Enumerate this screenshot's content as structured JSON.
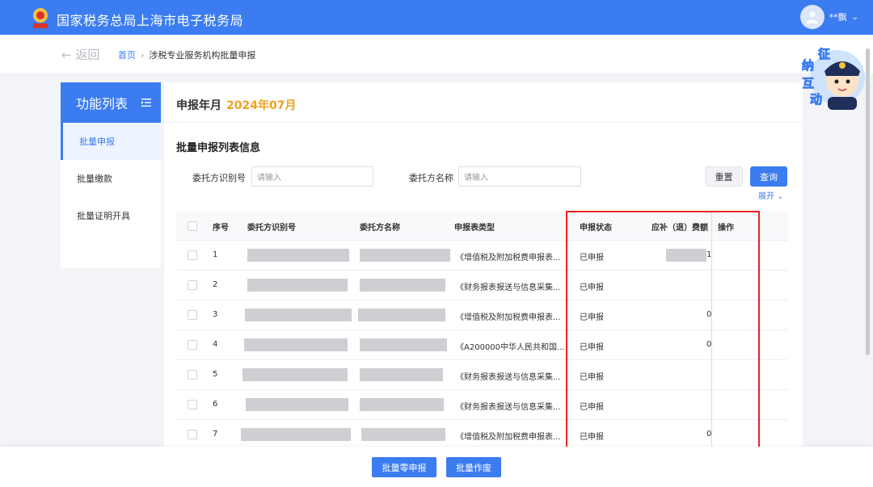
{
  "header": {
    "site_title": "国家税务总局上海市电子税务局",
    "user_name": "**飘",
    "logo_icon": "tax-emblem-icon",
    "user_icon": "user-avatar-icon"
  },
  "breadcrumb": {
    "back_label": "← 返回",
    "home": "首页",
    "separator": "›",
    "current": "涉税专业服务机构批量申报"
  },
  "mascot": {
    "chars": [
      "征",
      "纳",
      "互",
      "动"
    ]
  },
  "sidebar": {
    "title": "功能列表",
    "items": [
      {
        "label": "批量申报",
        "active": true
      },
      {
        "label": "批量缴款",
        "active": false
      },
      {
        "label": "批量证明开具",
        "active": false
      }
    ]
  },
  "main": {
    "period_label": "申报年月",
    "period_value": "2024年07月",
    "section_title": "批量申报列表信息",
    "filters": {
      "id_label": "委托方识别号",
      "id_placeholder": "请输入",
      "name_label": "委托方名称",
      "name_placeholder": "请输入"
    },
    "buttons": {
      "reset": "重置",
      "query": "查询",
      "expand": "展开 ⌄"
    }
  },
  "table": {
    "headers": [
      "序号",
      "委托方识别号",
      "委托方名称",
      "申报表类型",
      "申报状态",
      "应补（退）费额",
      "操作"
    ],
    "rows": [
      {
        "no": "1",
        "type": "《增值税及附加税费申报表...",
        "status": "已申报",
        "amount": "1"
      },
      {
        "no": "2",
        "type": "《财务报表报送与信息采集...",
        "status": "已申报",
        "amount": ""
      },
      {
        "no": "3",
        "type": "《增值税及附加税费申报表...",
        "status": "已申报",
        "amount": "0"
      },
      {
        "no": "4",
        "type": "《A200000中华人民共和国...",
        "status": "已申报",
        "amount": "0"
      },
      {
        "no": "5",
        "type": "《财务报表报送与信息采集...",
        "status": "已申报",
        "amount": ""
      },
      {
        "no": "6",
        "type": "《财务报表报送与信息采集...",
        "status": "已申报",
        "amount": ""
      },
      {
        "no": "7",
        "type": "《增值税及附加税费申报表...",
        "status": "已申报",
        "amount": "0"
      }
    ]
  },
  "footer": {
    "zero_declare": "批量零申报",
    "void": "批量作废"
  },
  "colors": {
    "primary": "#3b7cf0",
    "accent": "#f0a020",
    "highlight": "#e22222"
  }
}
